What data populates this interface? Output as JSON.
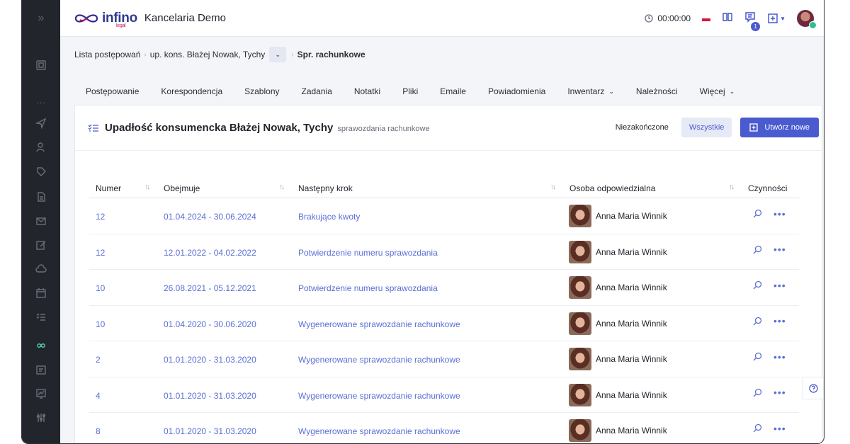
{
  "app": {
    "brand": "infino",
    "brand_sub": "legal",
    "title": "Kancelaria Demo"
  },
  "header": {
    "timer": "00:00:00",
    "notification_count": "1"
  },
  "breadcrumb": {
    "item1": "Lista postępowań",
    "item2": "up. kons. Błażej Nowak, Tychy",
    "current": "Spr. rachunkowe"
  },
  "tabs": [
    {
      "label": "Postępowanie"
    },
    {
      "label": "Korespondencja"
    },
    {
      "label": "Szablony"
    },
    {
      "label": "Zadania"
    },
    {
      "label": "Notatki"
    },
    {
      "label": "Pliki"
    },
    {
      "label": "Emaile"
    },
    {
      "label": "Powiadomienia"
    },
    {
      "label": "Inwentarz"
    },
    {
      "label": "Należności"
    },
    {
      "label": "Więcej"
    }
  ],
  "card": {
    "title": "Upadłość konsumencka Błażej Nowak, Tychy",
    "subtitle": "sprawozdania rachunkowe",
    "filter_unfinished": "Niezakończone",
    "filter_all": "Wszystkie",
    "create_new": "Utwórz nowe"
  },
  "table": {
    "headers": {
      "number": "Numer",
      "covers": "Obejmuje",
      "next_step": "Następny krok",
      "responsible": "Osoba odpowiedzialna",
      "actions": "Czynności"
    },
    "rows": [
      {
        "number": "12",
        "covers": "01.04.2024 - 30.06.2024",
        "next_step": "Brakujące kwoty",
        "person": "Anna Maria Winnik"
      },
      {
        "number": "12",
        "covers": "12.01.2022 - 04.02.2022",
        "next_step": "Potwierdzenie numeru sprawozdania",
        "person": "Anna Maria Winnik"
      },
      {
        "number": "10",
        "covers": "26.08.2021 - 05.12.2021",
        "next_step": "Potwierdzenie numeru sprawozdania",
        "person": "Anna Maria Winnik"
      },
      {
        "number": "10",
        "covers": "01.04.2020 - 30.06.2020",
        "next_step": "Wygenerowane sprawozdanie rachunkowe",
        "person": "Anna Maria Winnik"
      },
      {
        "number": "2",
        "covers": "01.01.2020 - 31.03.2020",
        "next_step": "Wygenerowane sprawozdanie rachunkowe",
        "person": "Anna Maria Winnik"
      },
      {
        "number": "4",
        "covers": "01.01.2020 - 31.03.2020",
        "next_step": "Wygenerowane sprawozdanie rachunkowe",
        "person": "Anna Maria Winnik"
      },
      {
        "number": "8",
        "covers": "01.01.2020 - 31.03.2020",
        "next_step": "Wygenerowane sprawozdanie rachunkowe",
        "person": "Anna Maria Winnik"
      }
    ]
  },
  "colors": {
    "sidebar": "#23252d",
    "accent": "#4a5bd0",
    "link": "#5a6fd6",
    "active_sidebar_icon": "#4ec9ad"
  }
}
